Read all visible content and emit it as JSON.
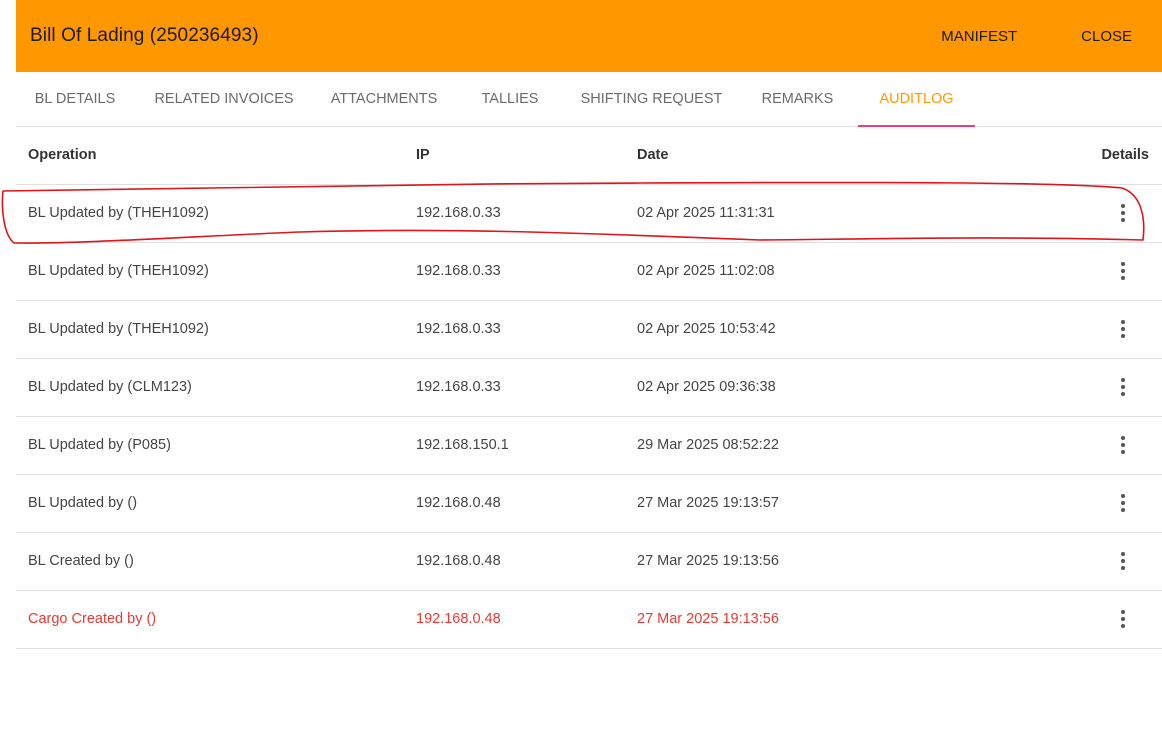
{
  "header": {
    "title": "Bill Of Lading (250236493)",
    "manifest_label": "MANIFEST",
    "close_label": "CLOSE",
    "background": "#ff9800"
  },
  "tabs": [
    {
      "label": "BL DETAILS",
      "active": false
    },
    {
      "label": "RELATED INVOICES",
      "active": false
    },
    {
      "label": "ATTACHMENTS",
      "active": false
    },
    {
      "label": "TALLIES",
      "active": false
    },
    {
      "label": "SHIFTING REQUEST",
      "active": false
    },
    {
      "label": "REMARKS",
      "active": false
    },
    {
      "label": "AUDITLOG",
      "active": true
    }
  ],
  "table": {
    "columns": {
      "operation": "Operation",
      "ip": "IP",
      "date": "Date",
      "details": "Details"
    },
    "rows": [
      {
        "operation": "BL Updated by (THEH1092)",
        "ip": "192.168.0.33",
        "date": "02 Apr 2025 11:31:31",
        "highlight": false
      },
      {
        "operation": "BL Updated by (THEH1092)",
        "ip": "192.168.0.33",
        "date": "02 Apr 2025 11:02:08",
        "highlight": false
      },
      {
        "operation": "BL Updated by (THEH1092)",
        "ip": "192.168.0.33",
        "date": "02 Apr 2025 10:53:42",
        "highlight": false
      },
      {
        "operation": "BL Updated by (CLM123)",
        "ip": "192.168.0.33",
        "date": "02 Apr 2025 09:36:38",
        "highlight": false
      },
      {
        "operation": "BL Updated by (P085)",
        "ip": "192.168.150.1",
        "date": "29 Mar 2025 08:52:22",
        "highlight": false
      },
      {
        "operation": "BL Updated by ()",
        "ip": "192.168.0.48",
        "date": "27 Mar 2025 19:13:57",
        "highlight": false
      },
      {
        "operation": "BL Created by ()",
        "ip": "192.168.0.48",
        "date": "27 Mar 2025 19:13:56",
        "highlight": false
      },
      {
        "operation": "Cargo Created by ()",
        "ip": "192.168.0.48",
        "date": "27 Mar 2025 19:13:56",
        "highlight": true
      }
    ]
  },
  "colors": {
    "accent": "#ff9800",
    "active_tab_indicator": "#ec407a",
    "highlight_text": "#e53935",
    "annotation_stroke": "#e0141b"
  },
  "icons": {
    "row_menu": "more-vert-icon"
  }
}
